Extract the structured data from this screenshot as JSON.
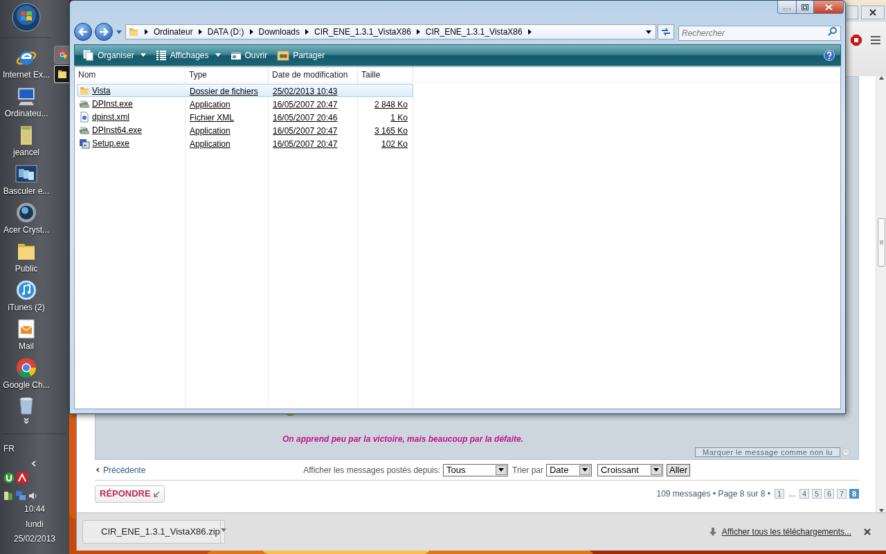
{
  "taskbar": {
    "desktop_items": [
      {
        "label": "Internet Ex...",
        "kind": "browser-e"
      },
      {
        "label": "Ordinateu...",
        "kind": "computer"
      },
      {
        "label": "jeancel",
        "kind": "user-folder"
      },
      {
        "label": "Basculer e...",
        "kind": "windows"
      },
      {
        "label": "Acer Cryst...",
        "kind": "sphere"
      },
      {
        "label": "Public",
        "kind": "folder"
      },
      {
        "label": "iTunes (2)",
        "kind": "music"
      },
      {
        "label": "Mail",
        "kind": "mail"
      },
      {
        "label": "Google Ch...",
        "kind": "chrome"
      }
    ],
    "tasks": [
      {
        "kind": "chrome",
        "selected": false
      },
      {
        "kind": "folder",
        "selected": true
      }
    ],
    "language": "FR",
    "time": "10:44",
    "day": "lundi",
    "date": "25/02/2013"
  },
  "explorer": {
    "breadcrumbs": [
      "Ordinateur",
      "DATA (D:)",
      "Downloads",
      "CIR_ENE_1.3.1_VistaX86",
      "CIR_ENE_1.3.1_VistaX86"
    ],
    "search": {
      "placeholder": "Rechercher"
    },
    "toolbar": [
      {
        "label": "Organiser",
        "kind": "organise",
        "dropdown": true
      },
      {
        "label": "Affichages",
        "kind": "views",
        "dropdown": true
      },
      {
        "label": "Ouvrir",
        "kind": "open",
        "dropdown": false
      },
      {
        "label": "Partager",
        "kind": "share",
        "dropdown": false
      }
    ],
    "columns": [
      "Nom",
      "Type",
      "Date de modification",
      "Taille"
    ],
    "rows": [
      {
        "name": "Vista",
        "type": "Dossier de fichiers",
        "date": "25/02/2013 10:43",
        "kind": "folder",
        "selected": true
      },
      {
        "name": "DPInst.exe",
        "type": "Application",
        "date": "16/05/2007 20:47",
        "size": "2 848 Ko",
        "kind": "installer",
        "selected": false
      },
      {
        "name": "dpinst.xml",
        "type": "Fichier XML",
        "date": "16/05/2007 20:46",
        "size": "1 Ko",
        "kind": "xml",
        "selected": false
      },
      {
        "name": "DPInst64.exe",
        "type": "Application",
        "date": "16/05/2007 20:47",
        "size": "3 165 Ko",
        "kind": "installer",
        "selected": false
      },
      {
        "name": "Setup.exe",
        "type": "Application",
        "date": "16/05/2007 20:47",
        "size": "102 Ko",
        "kind": "setup",
        "selected": false
      }
    ]
  },
  "browser": {
    "post": {
      "quote": "On apprend peu par la victoire, mais beaucoup par la défaite.",
      "mark_unread": "Marquer le message comme non lu"
    },
    "filters": {
      "previous": "Précédente",
      "since_label": "Afficher les messages postés depuis:",
      "since_value": "Tous",
      "sort_label": "Trier par",
      "sort_value": "Date",
      "order_value": "Croissant",
      "go": "Aller"
    },
    "reply": "RÉPONDRE",
    "pagination": {
      "summary": "109 messages • Page 8 sur 8 •",
      "pages": [
        {
          "label": "1",
          "kind": "page",
          "selected": false
        },
        {
          "label": "...",
          "kind": "gap"
        },
        {
          "label": "4",
          "kind": "page",
          "selected": false
        },
        {
          "label": "5",
          "kind": "page",
          "selected": false
        },
        {
          "label": "6",
          "kind": "page",
          "selected": false
        },
        {
          "label": "7",
          "kind": "page",
          "selected": false
        },
        {
          "label": "8",
          "kind": "page",
          "selected": true
        }
      ]
    },
    "downloads": {
      "file": "CIR_ENE_1.3.1_VistaX86.zip",
      "show_all": "Afficher tous les téléchargements..."
    }
  }
}
